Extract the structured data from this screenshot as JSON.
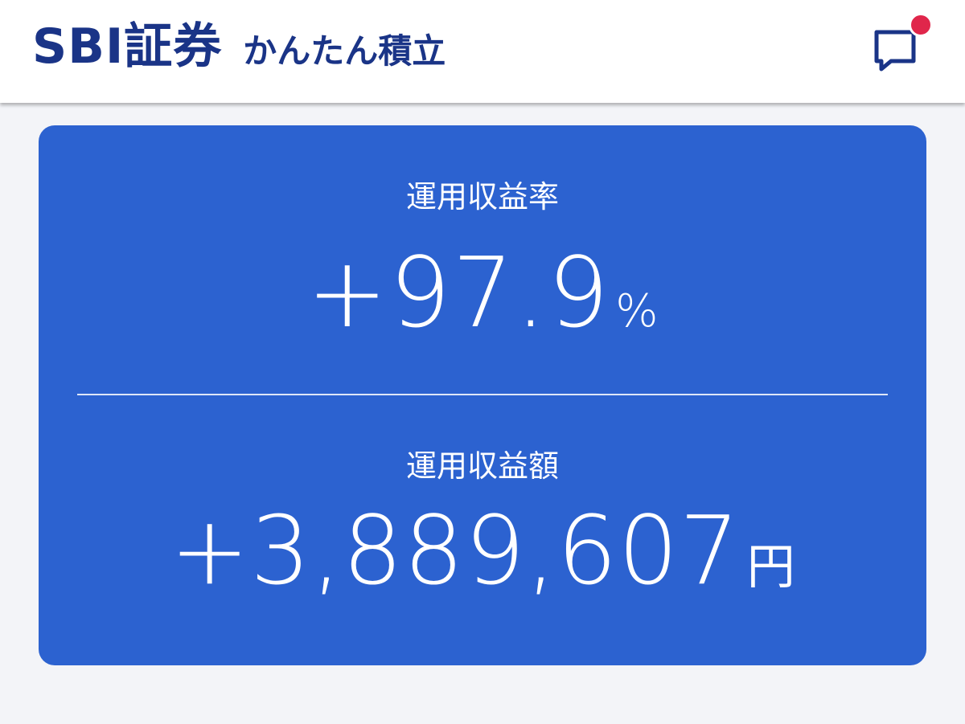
{
  "header": {
    "brand": "SBI証券",
    "service": "かんたん積立",
    "chat_icon": "chat-bubble-icon",
    "notification_color": "#e0264b"
  },
  "summary": {
    "rate_label": "運用収益率",
    "rate_value": "+97.9",
    "rate_unit": "%",
    "amount_label": "運用収益額",
    "amount_value": "+3,889,607",
    "amount_unit": "円"
  },
  "colors": {
    "brand": "#1a3487",
    "card": "#2c62d0",
    "background": "#f3f4f8"
  }
}
